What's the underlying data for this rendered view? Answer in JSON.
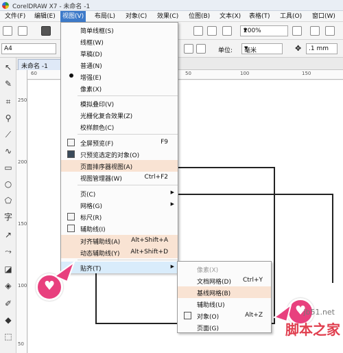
{
  "window": {
    "title": "CorelDRAW X7 - 未命名 -1"
  },
  "menubar": [
    "文件(F)",
    "编辑(E)",
    "视图(V)",
    "布局(L)",
    "对象(C)",
    "效果(C)",
    "位图(B)",
    "文本(X)",
    "表格(T)",
    "工具(O)",
    "窗口(W)"
  ],
  "toolbar": {
    "zoom": "200%",
    "page_size": "A4",
    "units_label": "单位:",
    "units": "毫米",
    "nudge": ".1 mm"
  },
  "document_tab": "未命名 -1",
  "ruler": {
    "h": [
      "60",
      "50",
      "100",
      "150"
    ],
    "v": [
      "250",
      "200",
      "150",
      "100",
      "50"
    ]
  },
  "view_menu": {
    "items": [
      {
        "label": "简单线框(S)"
      },
      {
        "label": "线框(W)"
      },
      {
        "label": "草稿(D)"
      },
      {
        "label": "普通(N)"
      },
      {
        "label": "增强(E)",
        "checked": true
      },
      {
        "label": "像素(X)"
      },
      {
        "label": "模拟叠印(V)"
      },
      {
        "label": "光栅化复合效果(Z)"
      },
      {
        "label": "校样颜色(C)"
      },
      {
        "label": "全屏预览(F)",
        "shortcut": "F9"
      },
      {
        "label": "只预览选定的对象(O)"
      },
      {
        "label": "页面排序器视图(A)"
      },
      {
        "label": "视图管理器(W)",
        "shortcut": "Ctrl+F2"
      },
      {
        "label": "页(C)",
        "submenu": true
      },
      {
        "label": "网格(G)",
        "submenu": true
      },
      {
        "label": "标尺(R)"
      },
      {
        "label": "辅助线(I)"
      },
      {
        "label": "对齐辅助线(A)",
        "shortcut": "Alt+Shift+A"
      },
      {
        "label": "动态辅助线(Y)",
        "shortcut": "Alt+Shift+D"
      },
      {
        "label": "贴齐(T)",
        "submenu": true
      }
    ]
  },
  "snap_submenu": {
    "items": [
      {
        "label": "像素(X)",
        "disabled": true
      },
      {
        "label": "文档网格(D)",
        "shortcut": "Ctrl+Y"
      },
      {
        "label": "基线网格(B)"
      },
      {
        "label": "辅助线(U)"
      },
      {
        "label": "对象(O)",
        "shortcut": "Alt+Z"
      },
      {
        "label": "页面(G)"
      }
    ]
  },
  "watermark": {
    "url": "jb51.net",
    "name": "脚本之家"
  },
  "colors": {
    "menu_active": "#3d7ac9",
    "highlight": "#f9e3d3",
    "pointer": "#e8407e",
    "watermark": "#e03f4f"
  }
}
